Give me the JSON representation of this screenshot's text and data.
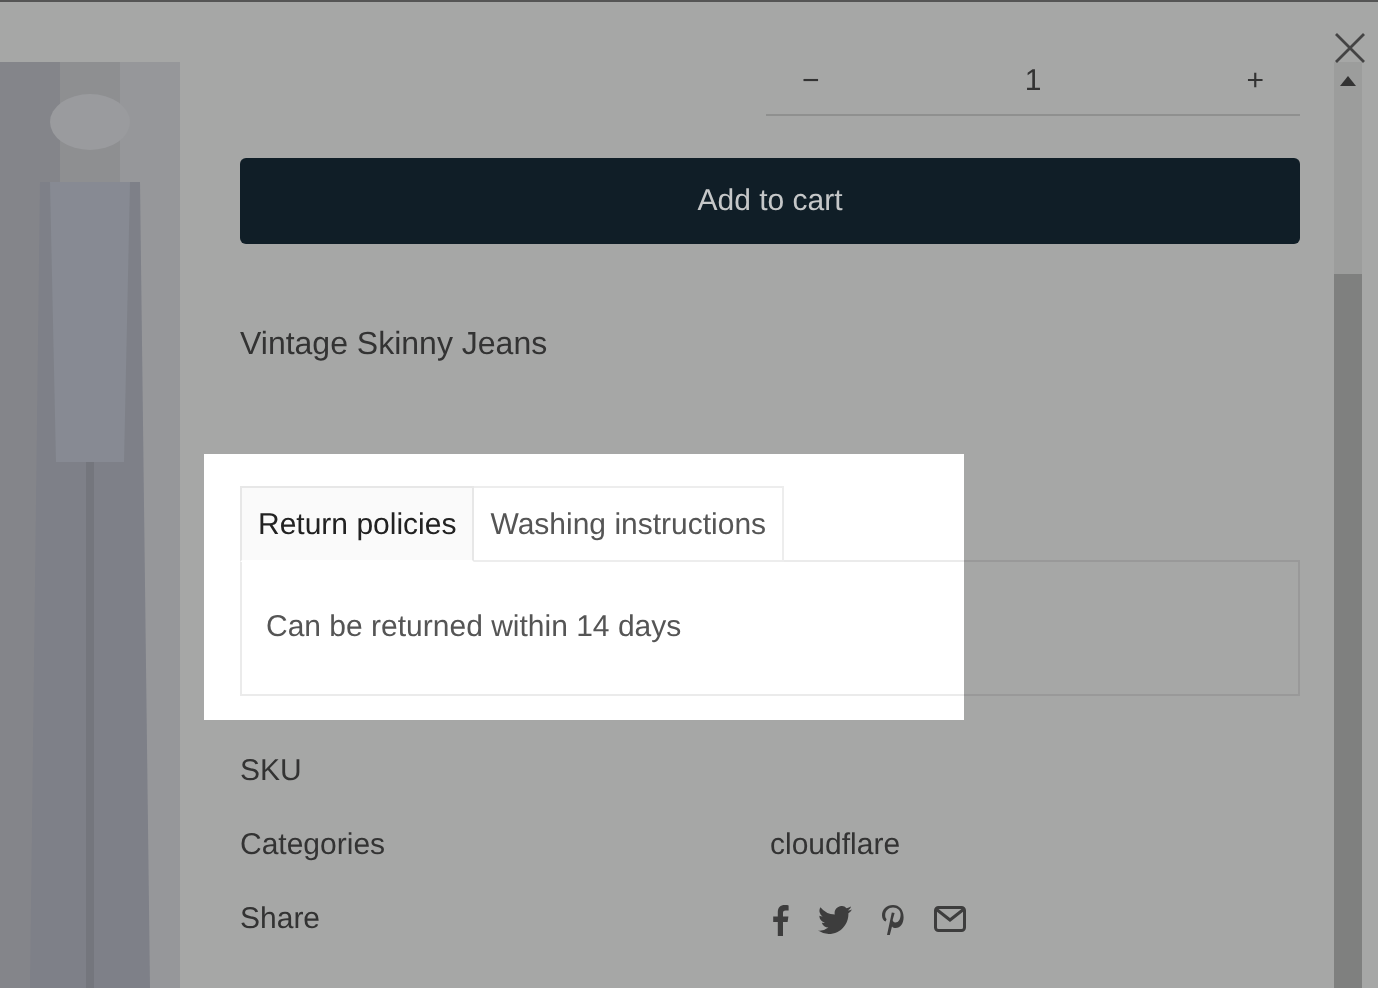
{
  "quantity": {
    "decrease": "−",
    "value": "1",
    "increase": "+"
  },
  "add_to_cart": "Add to cart",
  "product_name": "Vintage Skinny Jeans",
  "tabs": [
    {
      "label": "Return policies",
      "selected": true
    },
    {
      "label": "Washing instructions",
      "selected": false
    }
  ],
  "tab_content": "Can be returned within 14 days",
  "meta": [
    {
      "kind": "text",
      "label": "SKU"
    },
    {
      "kind": "text",
      "label": "Categories",
      "value": "cloudflare"
    },
    {
      "kind": "share",
      "label": "Share"
    }
  ]
}
